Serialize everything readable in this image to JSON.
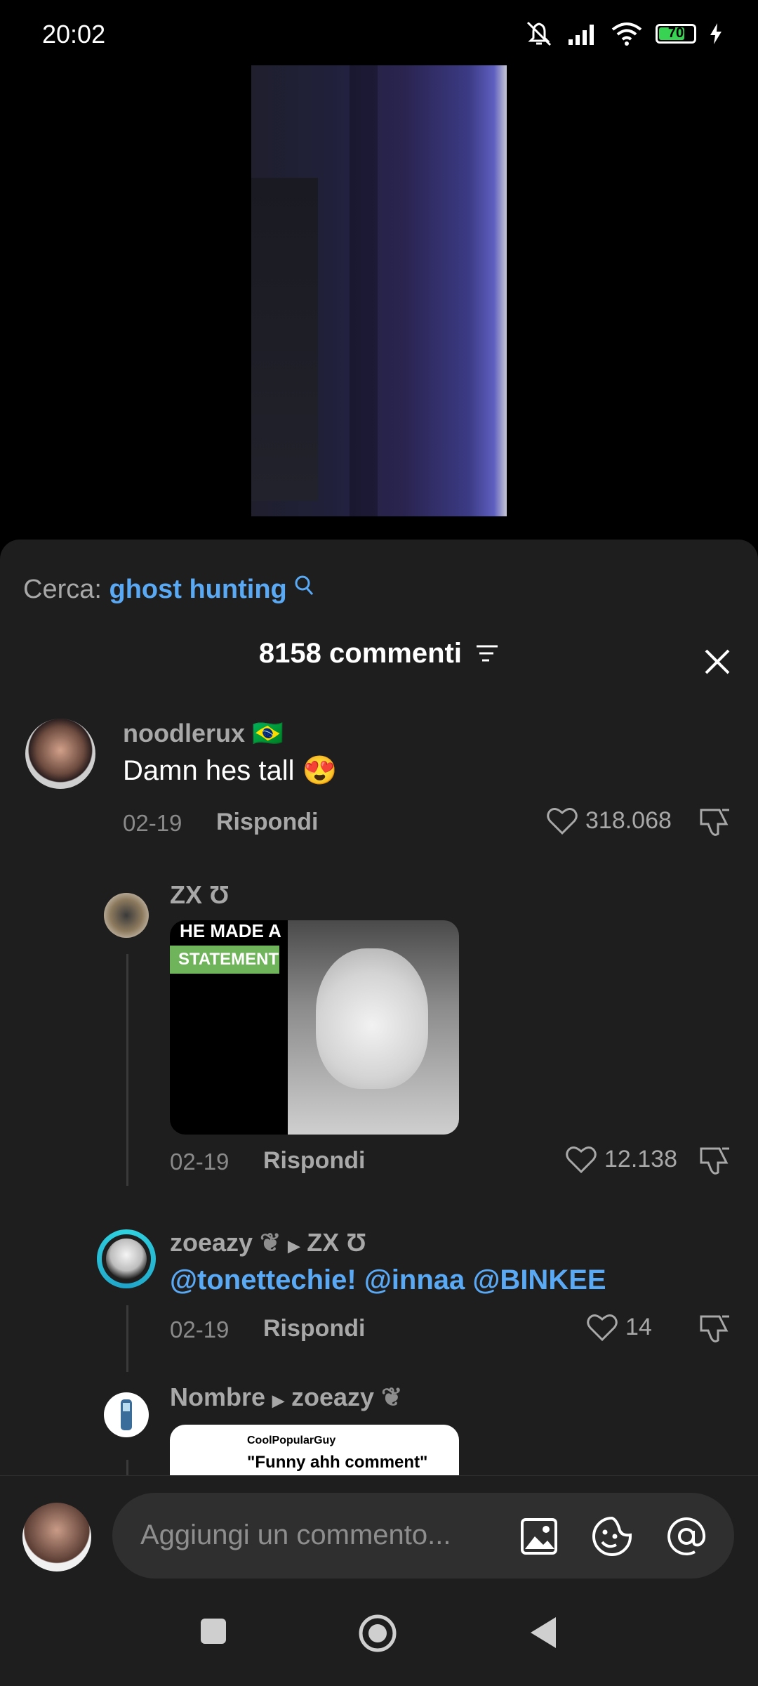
{
  "status_bar": {
    "time": "20:02",
    "battery": "70"
  },
  "search": {
    "label": "Cerca:",
    "term": "ghost hunting"
  },
  "comments_header": {
    "title": "8158 commenti"
  },
  "comments": [
    {
      "username": "noodlerux",
      "flag": "🇧🇷",
      "text": "Damn hes tall",
      "emoji": "😍",
      "date": "02-19",
      "reply_label": "Rispondi",
      "likes": "318.068"
    },
    {
      "username": "ZX Ʊ",
      "image_caption_line1": "HE MADE A",
      "image_caption_line2": "STATEMENT",
      "date": "02-19",
      "reply_label": "Rispondi",
      "likes": "12.138"
    },
    {
      "username": "zoeazy",
      "reply_to": "ZX Ʊ",
      "mentions": [
        "@tonettechie!",
        "@innaa",
        "@BINKEE"
      ],
      "date": "02-19",
      "reply_label": "Rispondi",
      "likes": "14"
    },
    {
      "username": "Nombre",
      "reply_to": "zoeazy",
      "image_caption_line1": "CoolPopularGuy",
      "image_caption_line2": "\"Funny ahh comment\""
    }
  ],
  "composer": {
    "placeholder": "Aggiungi un commento..."
  }
}
